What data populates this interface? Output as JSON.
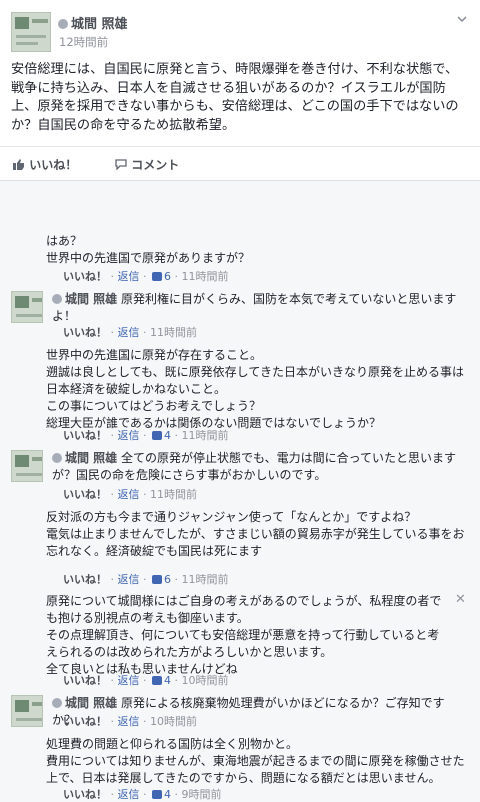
{
  "post": {
    "author": "城間 照雄",
    "time": "12時間前",
    "text": "安倍総理には、自国民に原発と言う、時限爆弾を巻き付け、不利な状態で、戦争に持ち込み、日本人を自滅させる狙いがあるのか？イスラエルが国防上、原発を採用できない事からも、安倍総理は、どこの国の手下ではないのか？自国民の命を守るため拡散希望。",
    "like_label": "いいね！",
    "comment_label": "コメント"
  },
  "comments": [
    {
      "text": "はあ？\n世界中の先進国で原発がありますが？",
      "like": "いいね！",
      "reply": "返信",
      "count": "6",
      "time": "11時間前"
    },
    {
      "author": "城間 照雄",
      "text": "原発利権に目がくらみ、国防を本気で考えていないと思いますよ！",
      "like": "いいね！",
      "reply": "返信",
      "time": "11時間前"
    },
    {
      "text": "世界中の先進国に原発が存在すること。\n遡誠は良しとしても、既に原発依存してきた日本がいきなり原発を止める事は日本経済を破綻しかねないこと。\nこの事についてはどうお考えでしょう？\n総理大臣が誰であるかは関係のない問題ではないでしょうか？",
      "like": "いいね！",
      "reply": "返信",
      "count": "4",
      "time": "11時間前"
    },
    {
      "author": "城間 照雄",
      "text": "全ての原発が停止状態でも、電力は間に合っていたと思いますが？国民の命を危険にさらす事がおかしいのです。",
      "like": "いいね！",
      "reply": "返信",
      "time": "11時間前"
    },
    {
      "text": "反対派の方も今まで通りジャンジャン使って「なんとか」ですよね？\n電気は止まりませんでしたが、すさまじい額の貿易赤字が発生している事をお忘れなく。経済破綻でも国民は死にます",
      "like": "いいね！",
      "reply": "返信",
      "count": "6",
      "time": "11時間前"
    },
    {
      "text": "原発について城間様にはご自身の考えがあるのでしょうが、私程度の者でも抱ける別視点の考えも御座います。\nその点理解頂き、何についても安倍総理が悪意を持って行動していると考えられるのは改められた方がよろしいかと思います。\n全て良いとは私も思いませんけどね",
      "like": "いいね！",
      "reply": "返信",
      "count": "4",
      "time": "10時間前"
    },
    {
      "author": "城間 照雄",
      "text": "原発による核廃棄物処理費がいかほどになるか？ご存知ですか？",
      "like": "いいね！",
      "reply": "返信",
      "time": "10時間前"
    },
    {
      "text": "処理費の問題と仰られる国防は全く別物かと。\n費用については知りませんが、東海地震が起きるまでの間に原発を稼働させた上で、日本は発展してきたのですから、問題になる額だとは思いません。",
      "like": "いいね！",
      "reply": "返信",
      "count": "4",
      "time": "9時間前"
    }
  ]
}
